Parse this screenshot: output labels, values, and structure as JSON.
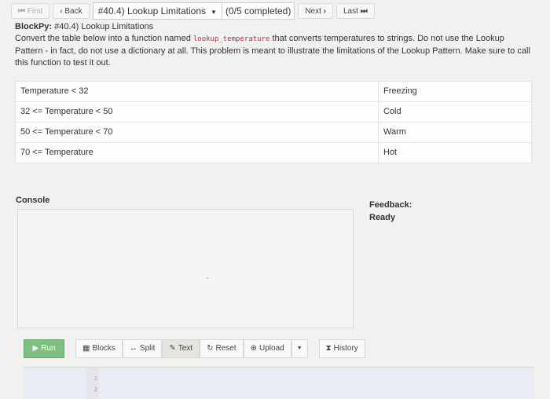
{
  "nav": {
    "first": "First",
    "back": "Back",
    "problem_select": "#40.4) Lookup Limitations",
    "completed": "(0/5 completed)",
    "next": "Next",
    "last": "Last"
  },
  "header": {
    "title_bold": "BlockPy:",
    "title_rest": " #40.4) Lookup Limitations",
    "desc_before": "Convert the table below into a function named ",
    "function_name": "lookup_temperature",
    "desc_after": " that converts temperatures to strings. Do not use the Lookup Pattern - in fact, do not use a dictionary at all. This problem is meant to illustrate the limitations of the Lookup Pattern. Make sure to call this function to test it out."
  },
  "table": {
    "rows": [
      {
        "condition": "Temperature < 32",
        "result": "Freezing"
      },
      {
        "condition": "32 <= Temperature < 50",
        "result": "Cold"
      },
      {
        "condition": "50 <= Temperature < 70",
        "result": "Warm"
      },
      {
        "condition": "70 <= Temperature",
        "result": "Hot"
      }
    ]
  },
  "console": {
    "label": "Console"
  },
  "feedback": {
    "label": "Feedback:",
    "status": "Ready"
  },
  "toolbar": {
    "run": "Run",
    "blocks": "Blocks",
    "split": "Split",
    "text": "Text",
    "reset": "Reset",
    "upload": "Upload",
    "history": "History"
  },
  "editor": {
    "line_numbers": [
      "1",
      "2"
    ]
  },
  "icons": {
    "first": "first-page-icon",
    "back": "chevron-left-icon",
    "next": "chevron-right-icon",
    "last": "last-page-icon",
    "run": "play-icon",
    "blocks": "blocks-icon",
    "split": "split-icon",
    "text": "pencil-icon",
    "reset": "refresh-icon",
    "upload": "upload-icon",
    "history": "hourglass-icon"
  },
  "colors": {
    "run_button": "#7fbf7f",
    "code": "#c7254e",
    "background": "#f1f1ef"
  }
}
